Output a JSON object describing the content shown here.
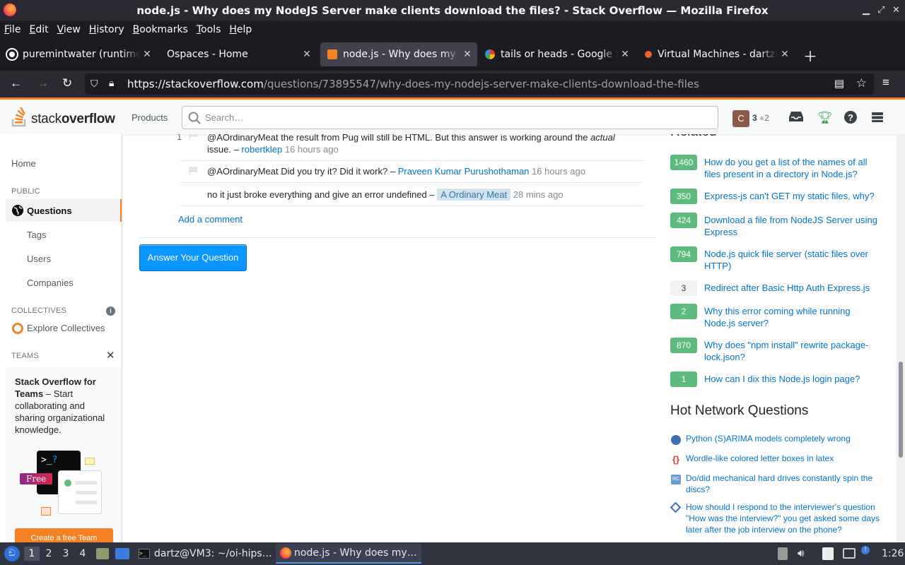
{
  "window": {
    "title": "node.js - Why does my NodeJS Server make clients download the files? - Stack Overflow — Mozilla Firefox"
  },
  "menubar": {
    "items": [
      {
        "ul": "F",
        "rest": "ile"
      },
      {
        "ul": "E",
        "rest": "dit"
      },
      {
        "ul": "V",
        "rest": "iew"
      },
      {
        "ul": "H",
        "rest": "istory"
      },
      {
        "ul": "B",
        "rest": "ookmarks"
      },
      {
        "ul": "T",
        "rest": "ools"
      },
      {
        "ul": "H",
        "rest": "elp"
      }
    ]
  },
  "tabs": [
    {
      "label": "puremintwater (runtime)",
      "favicon_color": "#fbfbfe"
    },
    {
      "label": "Ospaces - Home",
      "favicon_color": "#1c1b22"
    },
    {
      "label": "node.js - Why does my NodeJS",
      "favicon_color": "#f48225"
    },
    {
      "label": "tails or heads - Google Search",
      "favicon_color": "#4285f4"
    },
    {
      "label": "Virtual Machines - dartz@",
      "favicon_color": "#e8642b"
    }
  ],
  "url": {
    "host": "https://stackoverflow.com",
    "path": "/questions/73895547/why-does-my-nodejs-server-make-clients-download-the-files"
  },
  "so_header": {
    "logo_regular": "stack",
    "logo_bold": "overflow",
    "products": "Products",
    "search_placeholder": "Search…",
    "avatar_letter": "C",
    "reputation": "3",
    "bronze": "2"
  },
  "sidebar": {
    "home": "Home",
    "public_head": "PUBLIC",
    "questions": "Questions",
    "tags": "Tags",
    "users": "Users",
    "companies": "Companies",
    "collectives_head": "COLLECTIVES",
    "explore_collectives": "Explore Collectives",
    "teams_head": "TEAMS",
    "teams_title": "Stack Overflow for Teams",
    "teams_text": " – Start collaborating and sharing organizational knowledge.",
    "free_badge": "Free",
    "create_team": "Create a free Team"
  },
  "comments": [
    {
      "score": "1",
      "text_a": "@AOrdinaryMeat the result from Pug will still be HTML. But this answer is working around the ",
      "em": "actual",
      "text_b": " issue. – ",
      "user": "robertklep",
      "time": "16 hours ago"
    },
    {
      "text": "@AOrdinaryMeat Did you try it? Did it work? – ",
      "user": "Praveen Kumar Purushothaman",
      "time": "16 hours ago"
    },
    {
      "text": "no it just broke everything and give an error undefined – ",
      "user": "A Ordinary Meat",
      "time": "28 mins ago"
    }
  ],
  "add_comment": "Add a comment",
  "answer_button": "Answer Your Question",
  "related": {
    "heading": "Related",
    "items": [
      {
        "score": "1460",
        "title": "How do you get a list of the names of all files present in a directory in Node.js?"
      },
      {
        "score": "350",
        "title": "Express-js can't GET my static files, why?"
      },
      {
        "score": "424",
        "title": "Download a file from NodeJS Server using Express"
      },
      {
        "score": "794",
        "title": "Node.js quick file server (static files over HTTP)"
      },
      {
        "score": "3",
        "title": "Redirect after Basic Http Auth Express.js"
      },
      {
        "score": "2",
        "title": "Why this error coming while running Node.js server?"
      },
      {
        "score": "870",
        "title": "Why does \"npm install\" rewrite package-lock.json?"
      },
      {
        "score": "1",
        "title": "How can I dix this Node.js login page?"
      }
    ]
  },
  "hnq": {
    "heading": "Hot Network Questions",
    "items": [
      {
        "title": "Python (S)ARIMA models completely wrong",
        "icon_color": "#3e6fb0"
      },
      {
        "title": "Wordle-like colored letter boxes in latex",
        "icon_color": "#d43f2d"
      },
      {
        "title": "Do/did mechanical hard drives constantly spin the discs?",
        "icon_color": "#6c9bd2"
      },
      {
        "title": "How should I respond to the interviewer's question \"How was the interview?\" you get asked some days later after the job interview on the phone?",
        "icon_color": "#3a6bc4"
      }
    ]
  },
  "taskbar": {
    "workspaces": [
      "1",
      "2",
      "3",
      "4"
    ],
    "terminal_task": "dartz@VM3: ~/oi-hips…",
    "firefox_task": "node.js - Why does my…",
    "clock": "1:26"
  }
}
